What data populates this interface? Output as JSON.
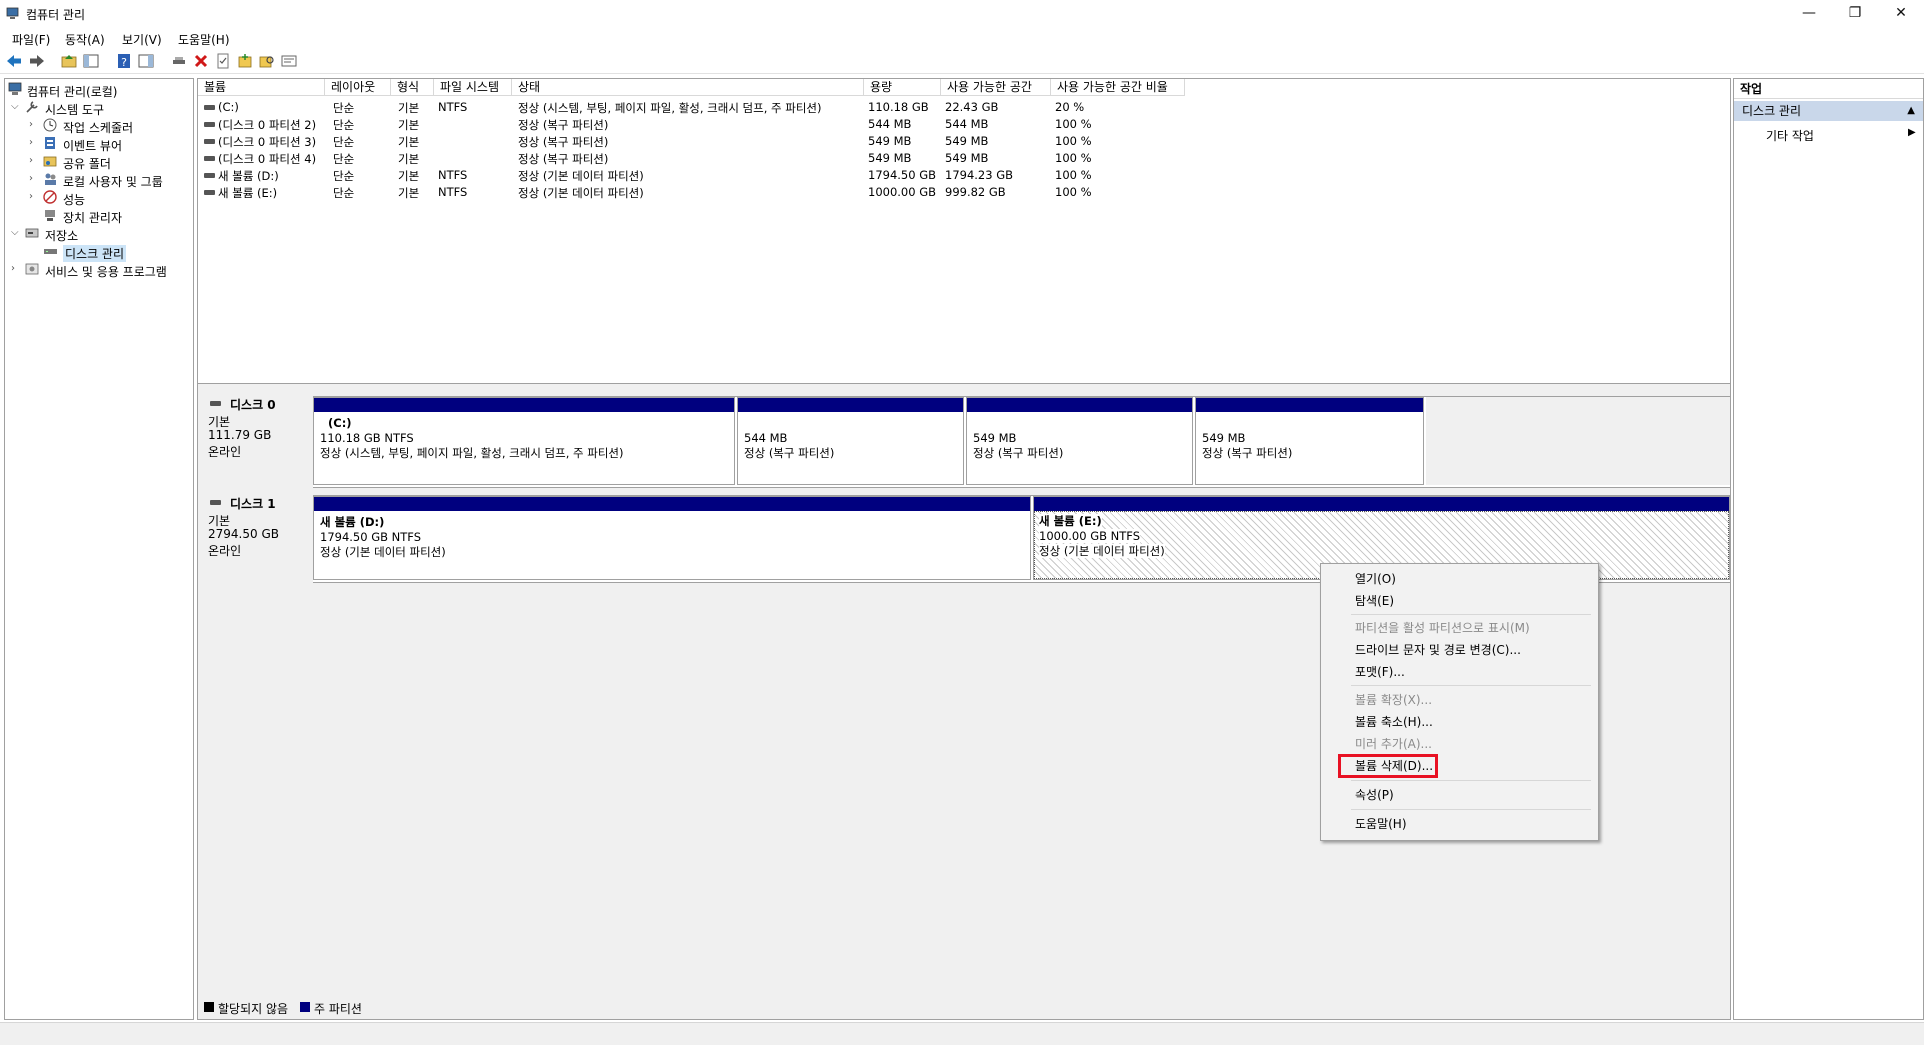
{
  "window": {
    "title": "컴퓨터 관리",
    "controls": [
      "—",
      "❐",
      "✕"
    ]
  },
  "menu": [
    "파일(F)",
    "동작(A)",
    "보기(V)",
    "도움말(H)"
  ],
  "tree": {
    "root": "컴퓨터 관리(로컬)",
    "system_tools": "시스템 도구",
    "task_scheduler": "작업 스케줄러",
    "event_viewer": "이벤트 뷰어",
    "shared_folders": "공유 폴더",
    "local_users": "로컬 사용자 및 그룹",
    "performance": "성능",
    "device_manager": "장치 관리자",
    "storage": "저장소",
    "disk_management": "디스크 관리",
    "services": "서비스 및 응용 프로그램"
  },
  "columns": [
    "볼륨",
    "레이아웃",
    "형식",
    "파일 시스템",
    "상태",
    "용량",
    "사용 가능한 공간",
    "사용 가능한 공간 비율"
  ],
  "volumes": [
    {
      "name": "(C:)",
      "layout": "단순",
      "type": "기본",
      "fs": "NTFS",
      "status": "정상 (시스템, 부팅, 페이지 파일, 활성, 크래시 덤프, 주 파티션)",
      "capacity": "110.18 GB",
      "free": "22.43 GB",
      "pct": "20 %"
    },
    {
      "name": "(디스크 0 파티션 2)",
      "layout": "단순",
      "type": "기본",
      "fs": "",
      "status": "정상 (복구 파티션)",
      "capacity": "544 MB",
      "free": "544 MB",
      "pct": "100 %"
    },
    {
      "name": "(디스크 0 파티션 3)",
      "layout": "단순",
      "type": "기본",
      "fs": "",
      "status": "정상 (복구 파티션)",
      "capacity": "549 MB",
      "free": "549 MB",
      "pct": "100 %"
    },
    {
      "name": "(디스크 0 파티션 4)",
      "layout": "단순",
      "type": "기본",
      "fs": "",
      "status": "정상 (복구 파티션)",
      "capacity": "549 MB",
      "free": "549 MB",
      "pct": "100 %"
    },
    {
      "name": "새 볼륨 (D:)",
      "layout": "단순",
      "type": "기본",
      "fs": "NTFS",
      "status": "정상 (기본 데이터 파티션)",
      "capacity": "1794.50 GB",
      "free": "1794.23 GB",
      "pct": "100 %"
    },
    {
      "name": "새 볼륨 (E:)",
      "layout": "단순",
      "type": "기본",
      "fs": "NTFS",
      "status": "정상 (기본 데이터 파티션)",
      "capacity": "1000.00 GB",
      "free": "999.82 GB",
      "pct": "100 %"
    }
  ],
  "disk0": {
    "name": "디스크 0",
    "type": "기본",
    "size": "111.79 GB",
    "state": "온라인",
    "parts": [
      {
        "title": "(C:)",
        "size": "110.18 GB NTFS",
        "status": "정상 (시스템, 부팅, 페이지 파일, 활성, 크래시 덤프, 주 파티션)"
      },
      {
        "title": "",
        "size": "544 MB",
        "status": "정상 (복구 파티션)"
      },
      {
        "title": "",
        "size": "549 MB",
        "status": "정상 (복구 파티션)"
      },
      {
        "title": "",
        "size": "549 MB",
        "status": "정상 (복구 파티션)"
      }
    ]
  },
  "disk1": {
    "name": "디스크 1",
    "type": "기본",
    "size": "2794.50 GB",
    "state": "온라인",
    "parts": [
      {
        "title": "새 볼륨  (D:)",
        "size": "1794.50 GB NTFS",
        "status": "정상 (기본 데이터 파티션)"
      },
      {
        "title": "새 볼륨  (E:)",
        "size": "1000.00 GB NTFS",
        "status": "정상 (기본 데이터 파티션)"
      }
    ]
  },
  "legend": {
    "unallocated": "할당되지 않음",
    "primary": "주 파티션"
  },
  "actions": {
    "header": "작업",
    "section": "디스크 관리",
    "other": "기타 작업"
  },
  "context_menu": {
    "open": "열기(O)",
    "explore": "탐색(E)",
    "mark_active": "파티션을 활성 파티션으로 표시(M)",
    "change_letter": "드라이브 문자 및 경로 변경(C)...",
    "format": "포맷(F)...",
    "extend": "볼륨 확장(X)...",
    "shrink": "볼륨 축소(H)...",
    "add_mirror": "미러 추가(A)...",
    "delete": "볼륨 삭제(D)...",
    "properties": "속성(P)",
    "help": "도움말(H)"
  },
  "colors": {
    "primary_partition": "#00007f",
    "unallocated": "#000000",
    "highlight": "#e81123",
    "selection": "#cce4f7"
  }
}
